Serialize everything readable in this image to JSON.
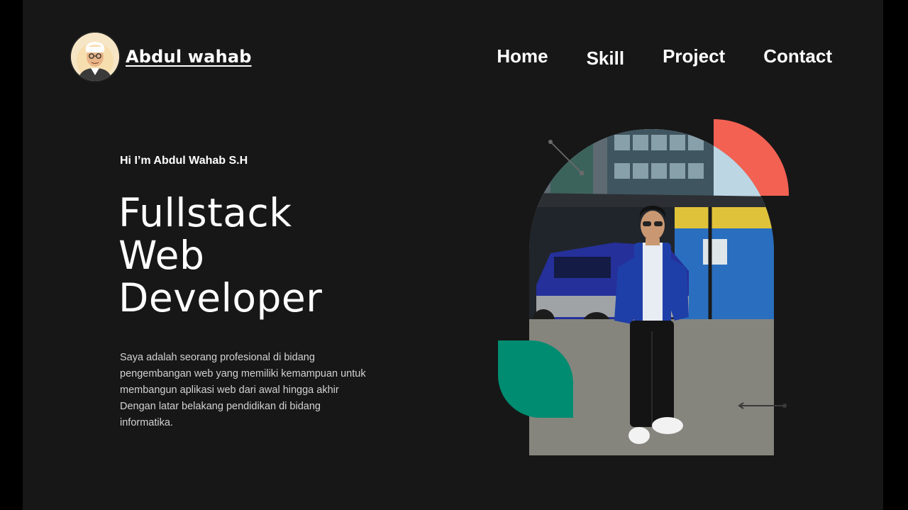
{
  "brand": {
    "name": "Abdul wahab",
    "avatar_icon": "person-avatar-icon"
  },
  "nav": {
    "items": [
      "Home",
      "Skill",
      "Project",
      "Contact"
    ]
  },
  "hero": {
    "greeting": "Hi  I’m Abdul Wahab S.H",
    "title_lines": [
      "Fullstack",
      "Web",
      "Developer"
    ],
    "description": "Saya adalah seorang profesional di bidang pengembangan web yang memiliki kemampuan untuk membangun aplikasi web dari awal hingga akhir Dengan latar belakang pendidikan di bidang informatika."
  },
  "colors": {
    "page_bg": "#171717",
    "outer_bg": "#000000",
    "accent_red": "#f26152",
    "accent_green": "#008c70",
    "text": "#ffffff"
  }
}
